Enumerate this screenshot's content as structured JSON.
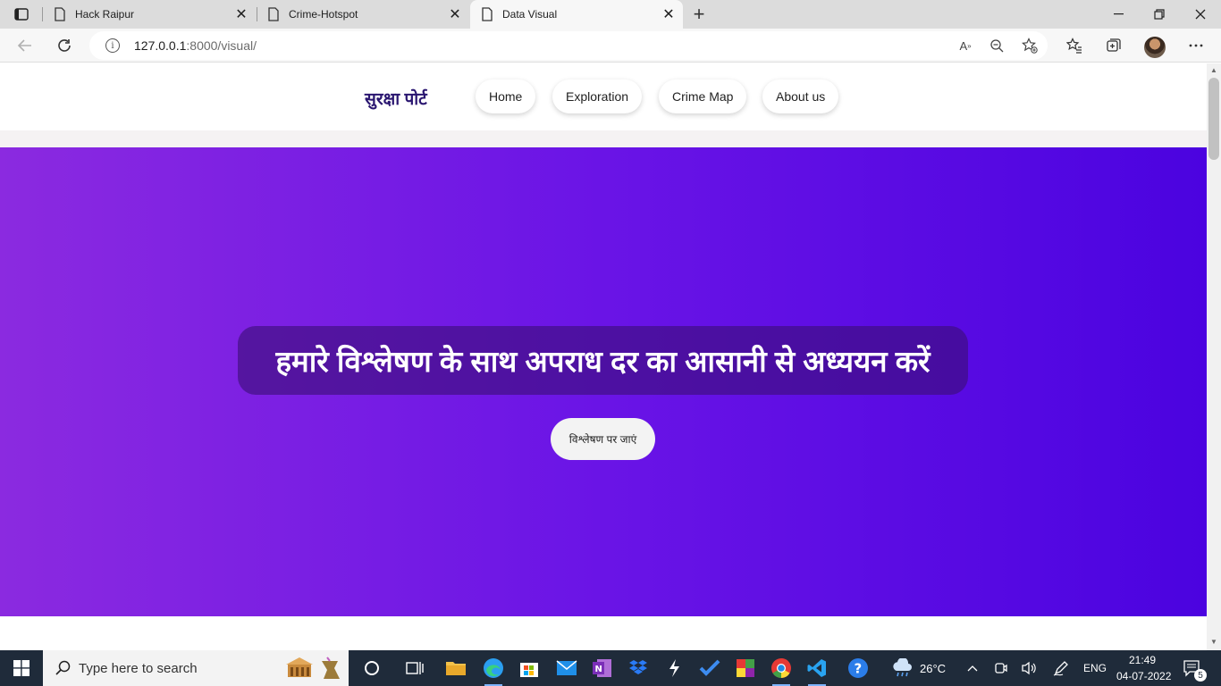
{
  "browser": {
    "tabs": [
      {
        "title": "Hack Raipur",
        "active": false
      },
      {
        "title": "Crime-Hotspot",
        "active": false
      },
      {
        "title": "Data Visual",
        "active": true
      }
    ],
    "url_host": "127.0.0.1",
    "url_path": ":8000/visual/"
  },
  "site": {
    "brand": "सुरक्षा पोर्ट",
    "nav": [
      {
        "label": "Home"
      },
      {
        "label": "Exploration"
      },
      {
        "label": "Crime Map"
      },
      {
        "label": "About us"
      }
    ],
    "hero": {
      "headline": "हमारे विश्लेषण के साथ अपराध दर का आसानी से अध्ययन करें",
      "cta_label": "विश्लेषण पर जाएं",
      "gradient_colors": [
        "#8b2ae0",
        "#4b03e0"
      ]
    }
  },
  "taskbar": {
    "search_placeholder": "Type here to search",
    "weather": "26°C",
    "language": "ENG",
    "time": "21:49",
    "date": "04-07-2022",
    "notification_count": "5"
  }
}
